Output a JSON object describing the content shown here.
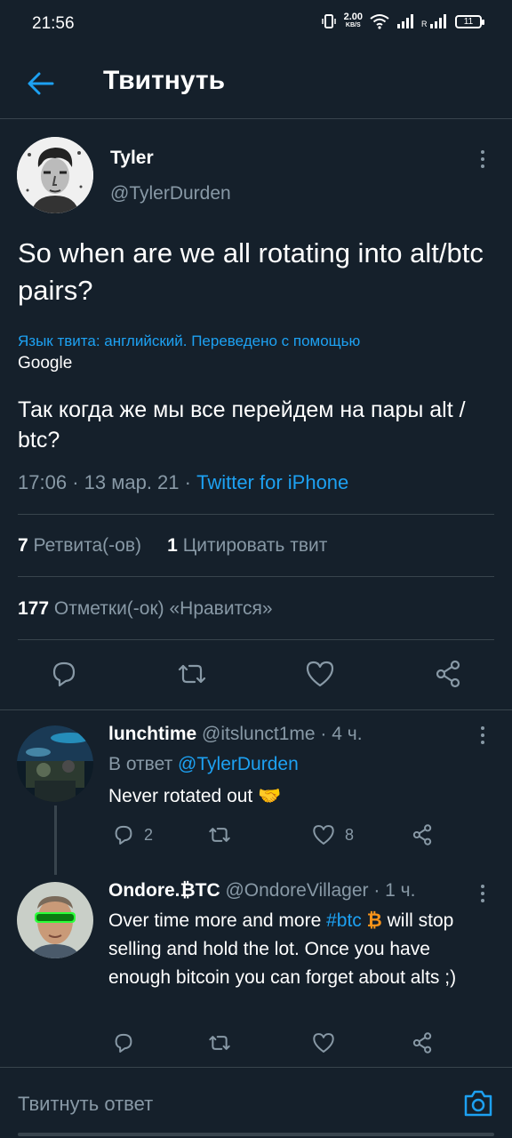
{
  "status_bar": {
    "time": "21:56",
    "net_speed_value": "2.00",
    "net_speed_unit": "KB/S",
    "battery": "11"
  },
  "header": {
    "title": "Твитнуть"
  },
  "tweet": {
    "author_name": "Tyler",
    "author_handle": "@TylerDurden",
    "text": "So when are we all rotating into alt/btc pairs?",
    "translation_note": "Язык твита: английский. Переведено с помощью",
    "translation_provider": "Google",
    "translated_text": "Так когда же мы все перейдем на пары alt / btc?",
    "time": "17:06",
    "date": "13 мар. 21",
    "source": "Twitter for iPhone",
    "retweets_count": "7",
    "retweets_label": "Ретвита(-ов)",
    "quotes_count": "1",
    "quotes_label": "Цитировать твит",
    "likes_count": "177",
    "likes_label": "Отметки(-ок) «Нравится»"
  },
  "replies": [
    {
      "name": "lunchtime",
      "handle": "@itslunct1me",
      "time": "4 ч.",
      "in_reply_prefix": "В ответ",
      "in_reply_to": "@TylerDurden",
      "text": "Never rotated out",
      "emoji": "🤝",
      "reply_count": "2",
      "retweet_count": "",
      "like_count": "8"
    },
    {
      "name": "Ondore.₿TC",
      "handle": "@OndoreVillager",
      "time": "1 ч.",
      "text_before": "Over time more and more",
      "hashtag": "#btc",
      "emoji": "₿",
      "text_after": "will stop selling and hold the lot. Once you have enough bitcoin you can forget about alts ;)",
      "reply_count": "",
      "retweet_count": "",
      "like_count": ""
    }
  ],
  "compose": {
    "placeholder": "Твитнуть ответ"
  },
  "colors": {
    "background": "#15202b",
    "accent": "#1da1f2",
    "muted": "#8899a6",
    "divider": "#38444d"
  },
  "icons": {
    "back": "arrow-left-icon",
    "more": "more-vertical-icon",
    "reply": "reply-icon",
    "retweet": "retweet-icon",
    "like": "heart-icon",
    "share": "share-icon",
    "camera": "camera-icon"
  }
}
